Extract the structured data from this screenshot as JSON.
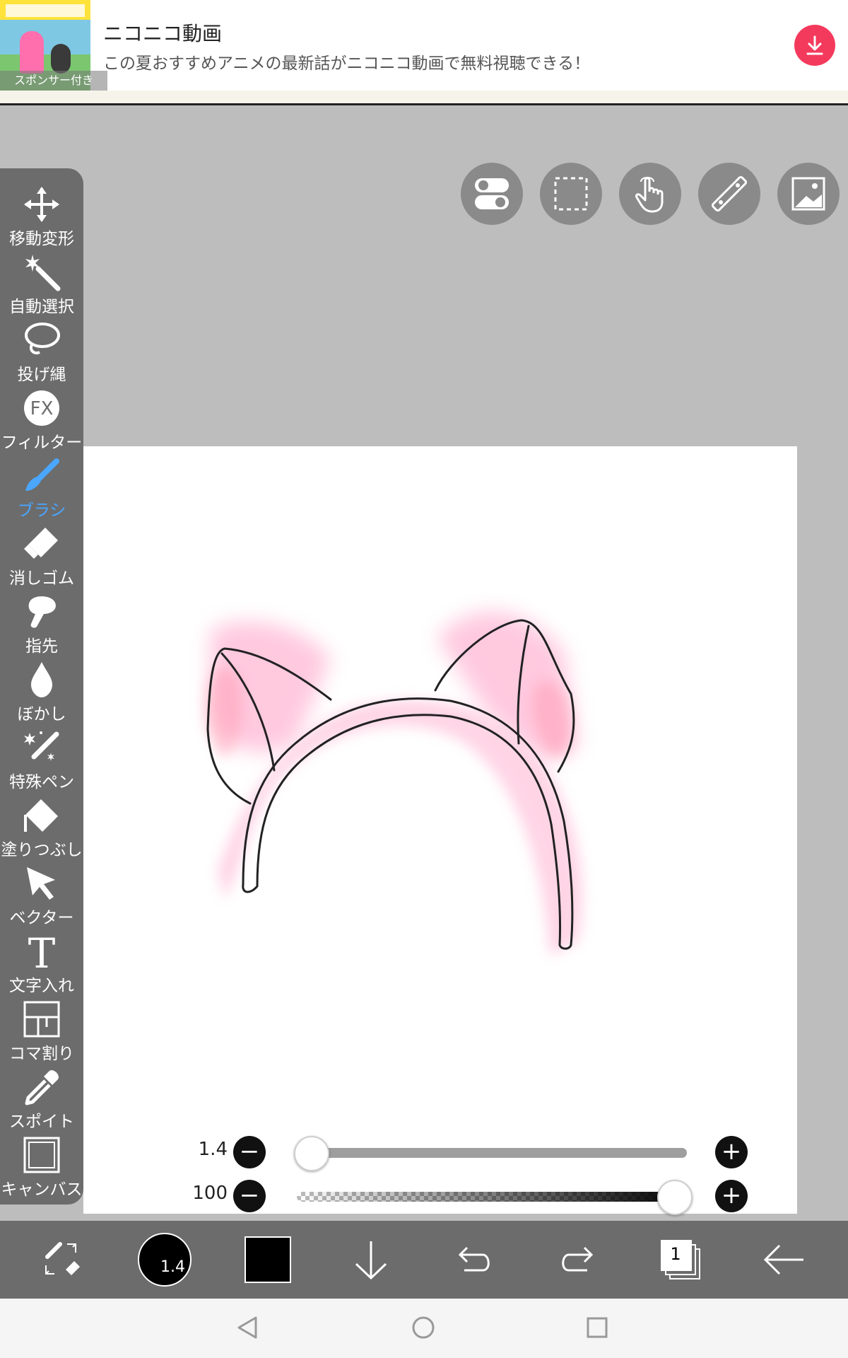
{
  "ad": {
    "title": "ニコニコ動画",
    "description": "この夏おすすめアニメの最新話がニコニコ動画で無料視聴できる！",
    "sponsor_label": "スポンサー付き",
    "download_icon": "download-icon",
    "accent_color": "#f43a5c"
  },
  "tools": [
    {
      "label": "移動変形",
      "icon": "move-transform-icon"
    },
    {
      "label": "自動選択",
      "icon": "magic-wand-icon"
    },
    {
      "label": "投げ縄",
      "icon": "lasso-icon"
    },
    {
      "label": "フィルター",
      "icon": "filter-fx-icon"
    },
    {
      "label": "ブラシ",
      "icon": "brush-icon",
      "active": true
    },
    {
      "label": "消しゴム",
      "icon": "eraser-icon"
    },
    {
      "label": "指先",
      "icon": "finger-smudge-icon"
    },
    {
      "label": "ぼかし",
      "icon": "blur-drop-icon"
    },
    {
      "label": "特殊ペン",
      "icon": "special-pen-icon"
    },
    {
      "label": "塗りつぶし",
      "icon": "fill-bucket-icon"
    },
    {
      "label": "ベクター",
      "icon": "vector-arrow-icon"
    },
    {
      "label": "文字入れ",
      "icon": "text-icon"
    },
    {
      "label": "コマ割り",
      "icon": "panel-divide-icon"
    },
    {
      "label": "スポイト",
      "icon": "eyedropper-icon"
    },
    {
      "label": "キャンバス",
      "icon": "canvas-icon"
    }
  ],
  "top_buttons": [
    "toggle-settings-icon",
    "selection-rect-icon",
    "touch-hand-icon",
    "ruler-icon",
    "image-icon"
  ],
  "sliders": {
    "size_value": "1.4",
    "size_fraction": 0.0,
    "opacity_value": "100",
    "opacity_fraction": 1.0
  },
  "bottom": {
    "brush_size_label": "1.4",
    "primary_color": "#000000",
    "layer_count": "1"
  },
  "accent_color": "#4aa6ff"
}
